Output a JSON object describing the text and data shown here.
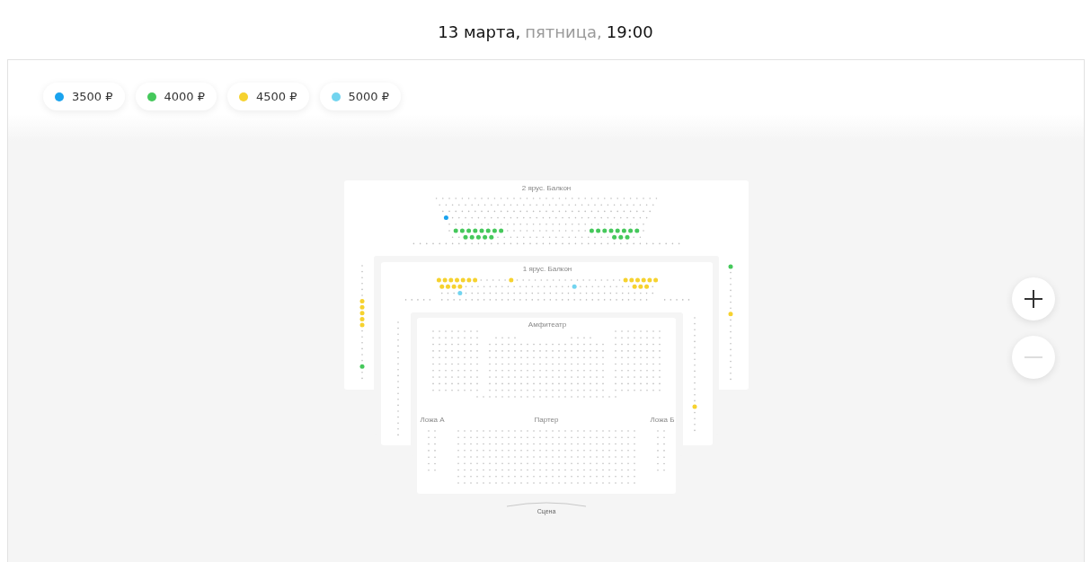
{
  "header": {
    "date": "13 марта,",
    "weekday": "пятница,",
    "time": "19:00"
  },
  "prices": [
    {
      "label": "3500 ₽",
      "color": "#1aa3ee"
    },
    {
      "label": "4000 ₽",
      "color": "#45c85b"
    },
    {
      "label": "4500 ₽",
      "color": "#f6d22f"
    },
    {
      "label": "5000 ₽",
      "color": "#72d4ef"
    }
  ],
  "zoom": {
    "zoom_in": {
      "disabled": false
    },
    "zoom_out": {
      "disabled": true
    }
  },
  "map": {
    "sections": [
      {
        "title": "2 ярус. Балкон",
        "seats": [
          {
            "color": "#1aa3ee"
          },
          {
            "color": "#45c85b"
          },
          {
            "color": "#45c85b"
          },
          {
            "color": "#45c85b"
          },
          {
            "color": "#45c85b"
          },
          {
            "color": "#45c85b"
          },
          {
            "color": "#45c85b"
          },
          {
            "color": "#45c85b"
          },
          {
            "color": "#45c85b"
          },
          {
            "color": "#45c85b"
          },
          {
            "color": "#45c85b"
          },
          {
            "color": "#45c85b"
          },
          {
            "color": "#45c85b"
          },
          {
            "color": "#45c85b"
          },
          {
            "color": "#45c85b"
          },
          {
            "color": "#45c85b"
          },
          {
            "color": "#45c85b"
          },
          {
            "color": "#45c85b"
          },
          {
            "color": "#45c85b"
          },
          {
            "color": "#45c85b"
          },
          {
            "color": "#45c85b"
          },
          {
            "color": "#45c85b"
          },
          {
            "color": "#45c85b"
          },
          {
            "color": "#45c85b"
          },
          {
            "color": "#45c85b"
          },
          {
            "color": "#f6d22f"
          },
          {
            "color": "#f6d22f"
          },
          {
            "color": "#f6d22f"
          },
          {
            "color": "#f6d22f"
          },
          {
            "color": "#f6d22f"
          },
          {
            "color": "#45c85b"
          },
          {
            "color": "#45c85b"
          },
          {
            "color": "#f6d22f"
          }
        ]
      },
      {
        "title": "1 ярус. Балкон",
        "seats": [
          {
            "color": "#f6d22f"
          },
          {
            "color": "#f6d22f"
          },
          {
            "color": "#f6d22f"
          },
          {
            "color": "#f6d22f"
          },
          {
            "color": "#f6d22f"
          },
          {
            "color": "#f6d22f"
          },
          {
            "color": "#f6d22f"
          },
          {
            "color": "#f6d22f"
          },
          {
            "color": "#f6d22f"
          },
          {
            "color": "#f6d22f"
          },
          {
            "color": "#f6d22f"
          },
          {
            "color": "#f6d22f"
          },
          {
            "color": "#f6d22f"
          },
          {
            "color": "#f6d22f"
          },
          {
            "color": "#f6d22f"
          },
          {
            "color": "#f6d22f"
          },
          {
            "color": "#f6d22f"
          },
          {
            "color": "#f6d22f"
          },
          {
            "color": "#72d4ef"
          },
          {
            "color": "#f6d22f"
          },
          {
            "color": "#f6d22f"
          },
          {
            "color": "#f6d22f"
          },
          {
            "color": "#72d4ef"
          },
          {
            "color": "#f6d22f"
          }
        ]
      },
      {
        "title": "Амфитеатр"
      },
      {
        "title": "Ложа А"
      },
      {
        "title": "Партер"
      },
      {
        "title": "Ложа Б"
      }
    ],
    "stage": "Сцена"
  }
}
